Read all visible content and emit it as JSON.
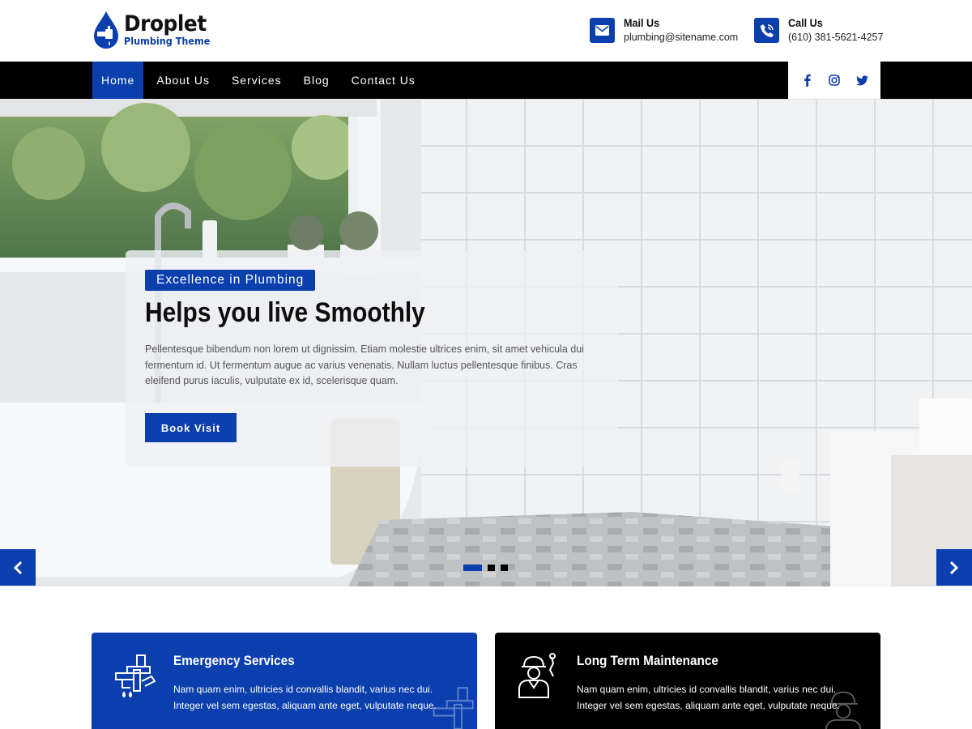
{
  "brand": {
    "name": "Droplet",
    "tagline": "Plumbing Theme"
  },
  "header": {
    "mail": {
      "title": "Mail Us",
      "value": "plumbing@sitename.com",
      "icon": "envelope-icon"
    },
    "call": {
      "title": "Call Us",
      "value": "(610) 381-5621-4257",
      "icon": "phone-icon"
    }
  },
  "nav": {
    "items": [
      {
        "label": "Home",
        "active": true
      },
      {
        "label": "About Us"
      },
      {
        "label": "Services"
      },
      {
        "label": "Blog"
      },
      {
        "label": "Contact Us"
      }
    ],
    "social": [
      "facebook-icon",
      "instagram-icon",
      "twitter-icon"
    ]
  },
  "hero": {
    "badge": "Excellence in Plumbing",
    "headline": "Helps you live Smoothly",
    "description": "Pellentesque bibendum non lorem ut dignissim. Etiam molestie ultrices enim, sit amet vehicula dui fermentum id. Ut fermentum augue ac varius venenatis. Nullam luctus pellentesque finibus. Cras eleifend purus iaculis, vulputate ex id, scelerisque quam.",
    "button": "Book Visit",
    "slides": 3,
    "active_slide": 1
  },
  "services": [
    {
      "title": "Emergency Services",
      "text": "Nam quam enim, ultricies id convallis blandit, varius nec dui. Integer vel sem egestas, aliquam ante eget, vulputate neque.",
      "icon": "pipe-wrench-icon"
    },
    {
      "title": "Long Term Maintenance",
      "text": "Nam quam enim, ultricies id convallis blandit, varius nec dui. Integer vel sem egestas, aliquam ante eget, vulputate neque.",
      "icon": "plumber-worker-icon"
    }
  ],
  "colors": {
    "accent": "#0b3fae",
    "dark": "#000000"
  }
}
